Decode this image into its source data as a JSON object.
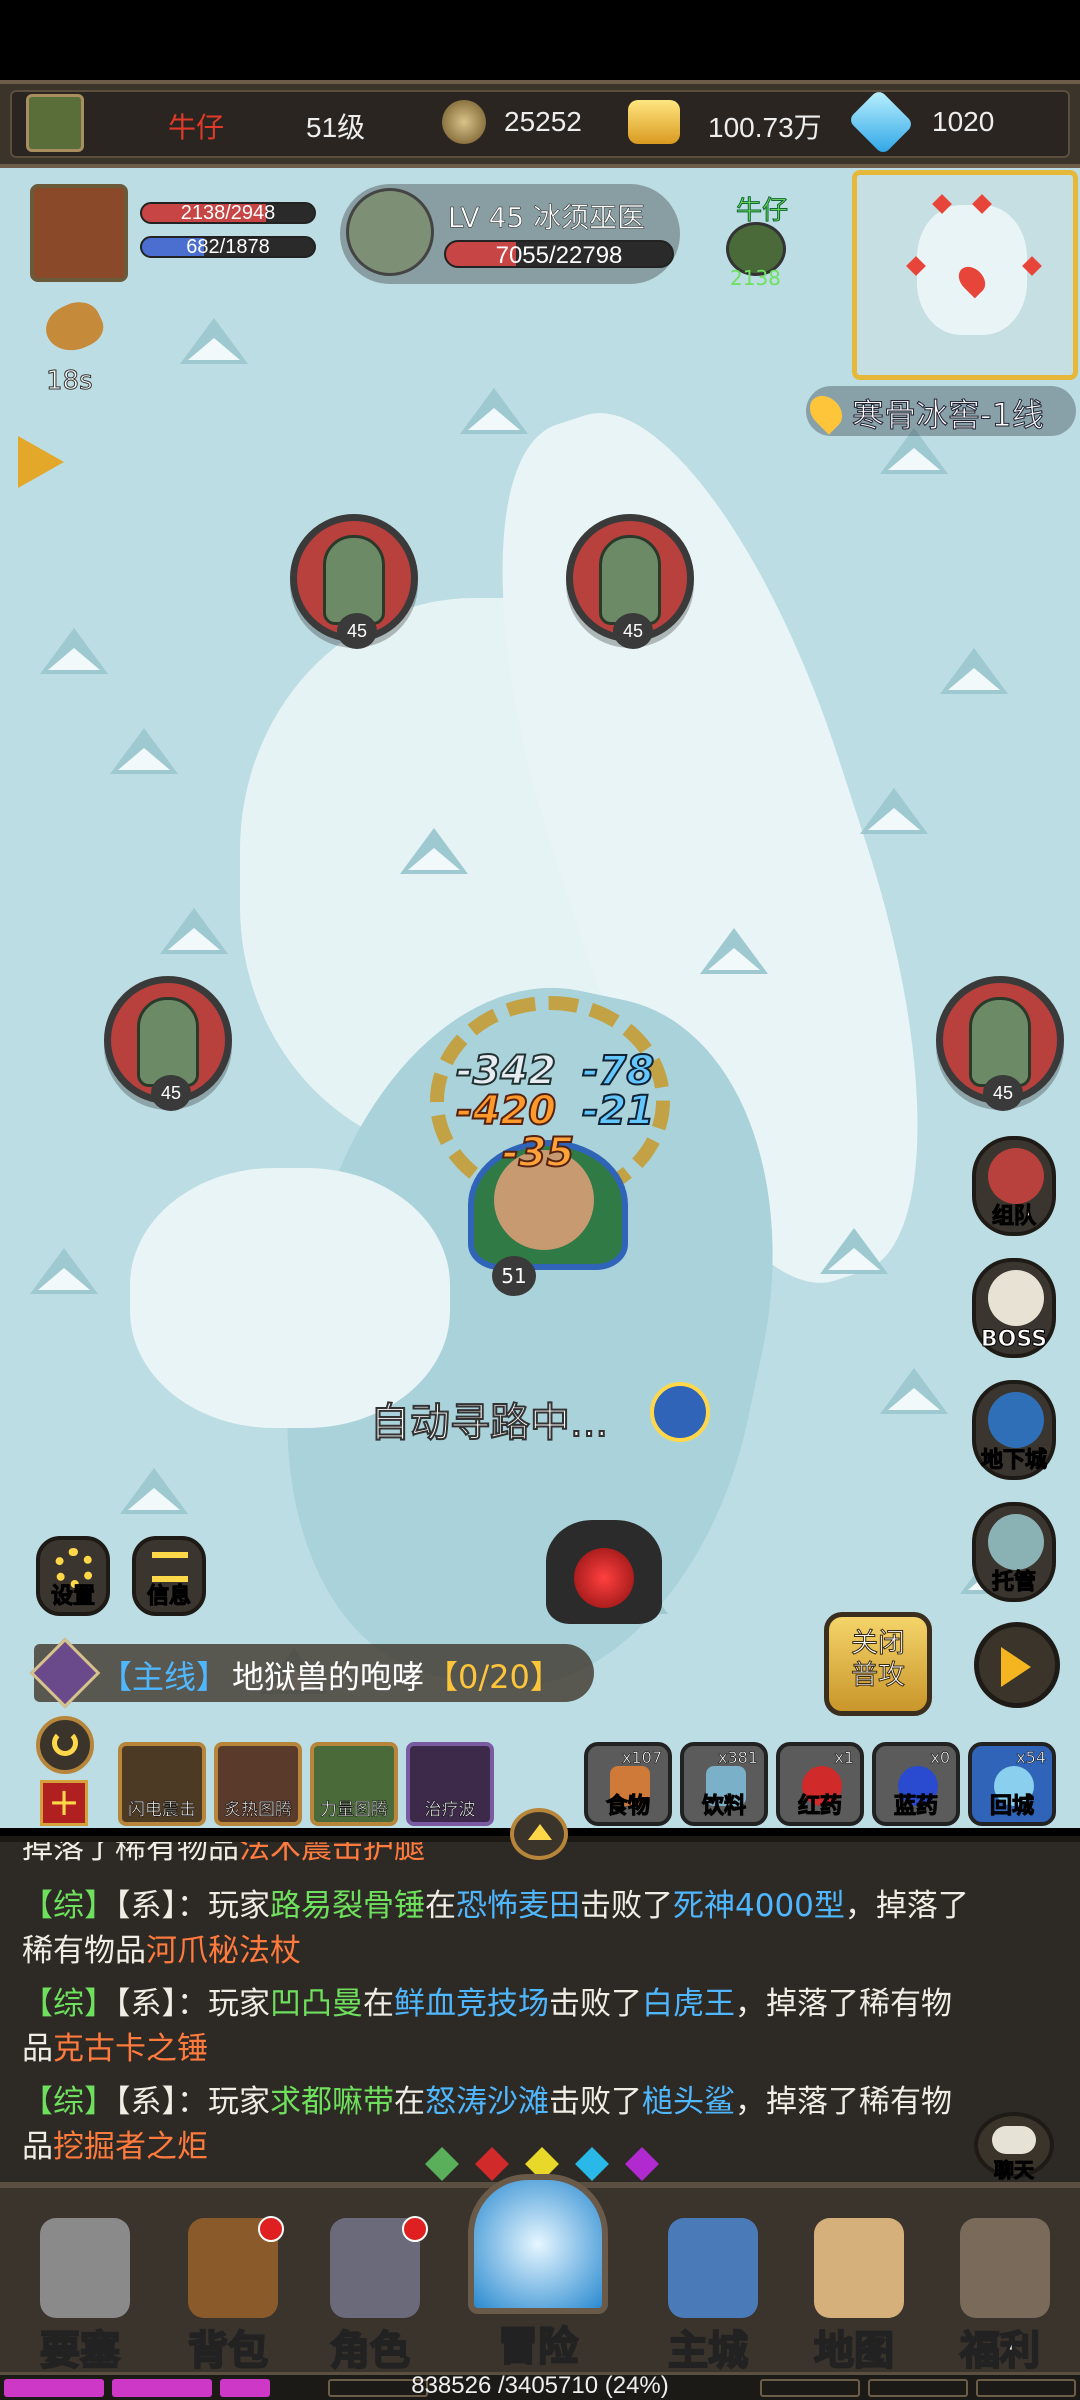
{
  "player": {
    "name": "牛仔",
    "level": "51级",
    "currency1": "25252",
    "gold": "100.73万",
    "diamond": "1020"
  },
  "hero": {
    "hp": "2138/2948",
    "mp": "682/1878",
    "buff_timer": "18s"
  },
  "target": {
    "name": "LV 45 冰须巫医",
    "hp": "7055/22798"
  },
  "ally": {
    "name": "牛仔",
    "hp": "2138"
  },
  "map": {
    "location": "寒骨冰窖-1线"
  },
  "mobs": {
    "level": "45"
  },
  "player_avatar_level": "51",
  "damage_numbers": [
    "-342",
    "-78",
    "-420",
    "-21",
    "-35"
  ],
  "side_buttons": {
    "team": "组队",
    "boss": "BOSS",
    "dungeon": "地下城",
    "auto": "托管"
  },
  "left_buttons": {
    "settings": "设置",
    "info": "信息"
  },
  "pathing": "自动寻路中...",
  "quest": {
    "tag": "【主线】",
    "title": "地狱兽的咆哮",
    "progress": "【0/20】"
  },
  "attack_toggle": "关闭\n普攻",
  "skills": [
    "闪电震击",
    "炙热图腾",
    "力量图腾",
    "治疗波"
  ],
  "items": [
    {
      "label": "食物",
      "count": "x107"
    },
    {
      "label": "饮料",
      "count": "x381"
    },
    {
      "label": "红药",
      "count": "x1"
    },
    {
      "label": "蓝药",
      "count": "x0"
    },
    {
      "label": "回城",
      "count": "x54"
    }
  ],
  "chat": {
    "line0": {
      "pre": "掉落了稀有物品",
      "item": "法术震击护腿"
    },
    "line1": {
      "tag": "【综】",
      "sys": "【系】：",
      "p1": "玩家",
      "player": "路易裂骨锤",
      "p2": "在",
      "place": "恐怖麦田",
      "p3": "击败了",
      "boss": "死神4000型",
      "p4": "，掉落了稀有物品",
      "item": "河爪秘法杖"
    },
    "line2": {
      "tag": "【综】",
      "sys": "【系】：",
      "p1": "玩家",
      "player": "凹凸曼",
      "p2": "在",
      "place": "鲜血竞技场",
      "p3": "击败了",
      "boss": "白虎王",
      "p4": "，掉落了稀有物品",
      "item": "克古卡之锤"
    },
    "line3": {
      "tag": "【综】",
      "sys": "【系】：",
      "p1": "玩家",
      "player": "求都嘛带",
      "p2": "在",
      "place": "怒涛沙滩",
      "p3": "击败了",
      "boss": "槌头鲨",
      "p4": "，掉落了稀有物品",
      "item": "挖掘者之炬"
    },
    "chat_button": "聊天"
  },
  "nav": [
    "要塞",
    "背包",
    "角色",
    "冒险",
    "主城",
    "地图",
    "福利"
  ],
  "xp": {
    "text": "838526 /3405710 (24%)",
    "fraction": 0.24
  },
  "colors": {
    "hp": "#c84545",
    "mp": "#4a6fd0",
    "accent": "#ffd84a",
    "xp": "#ce38c6"
  }
}
